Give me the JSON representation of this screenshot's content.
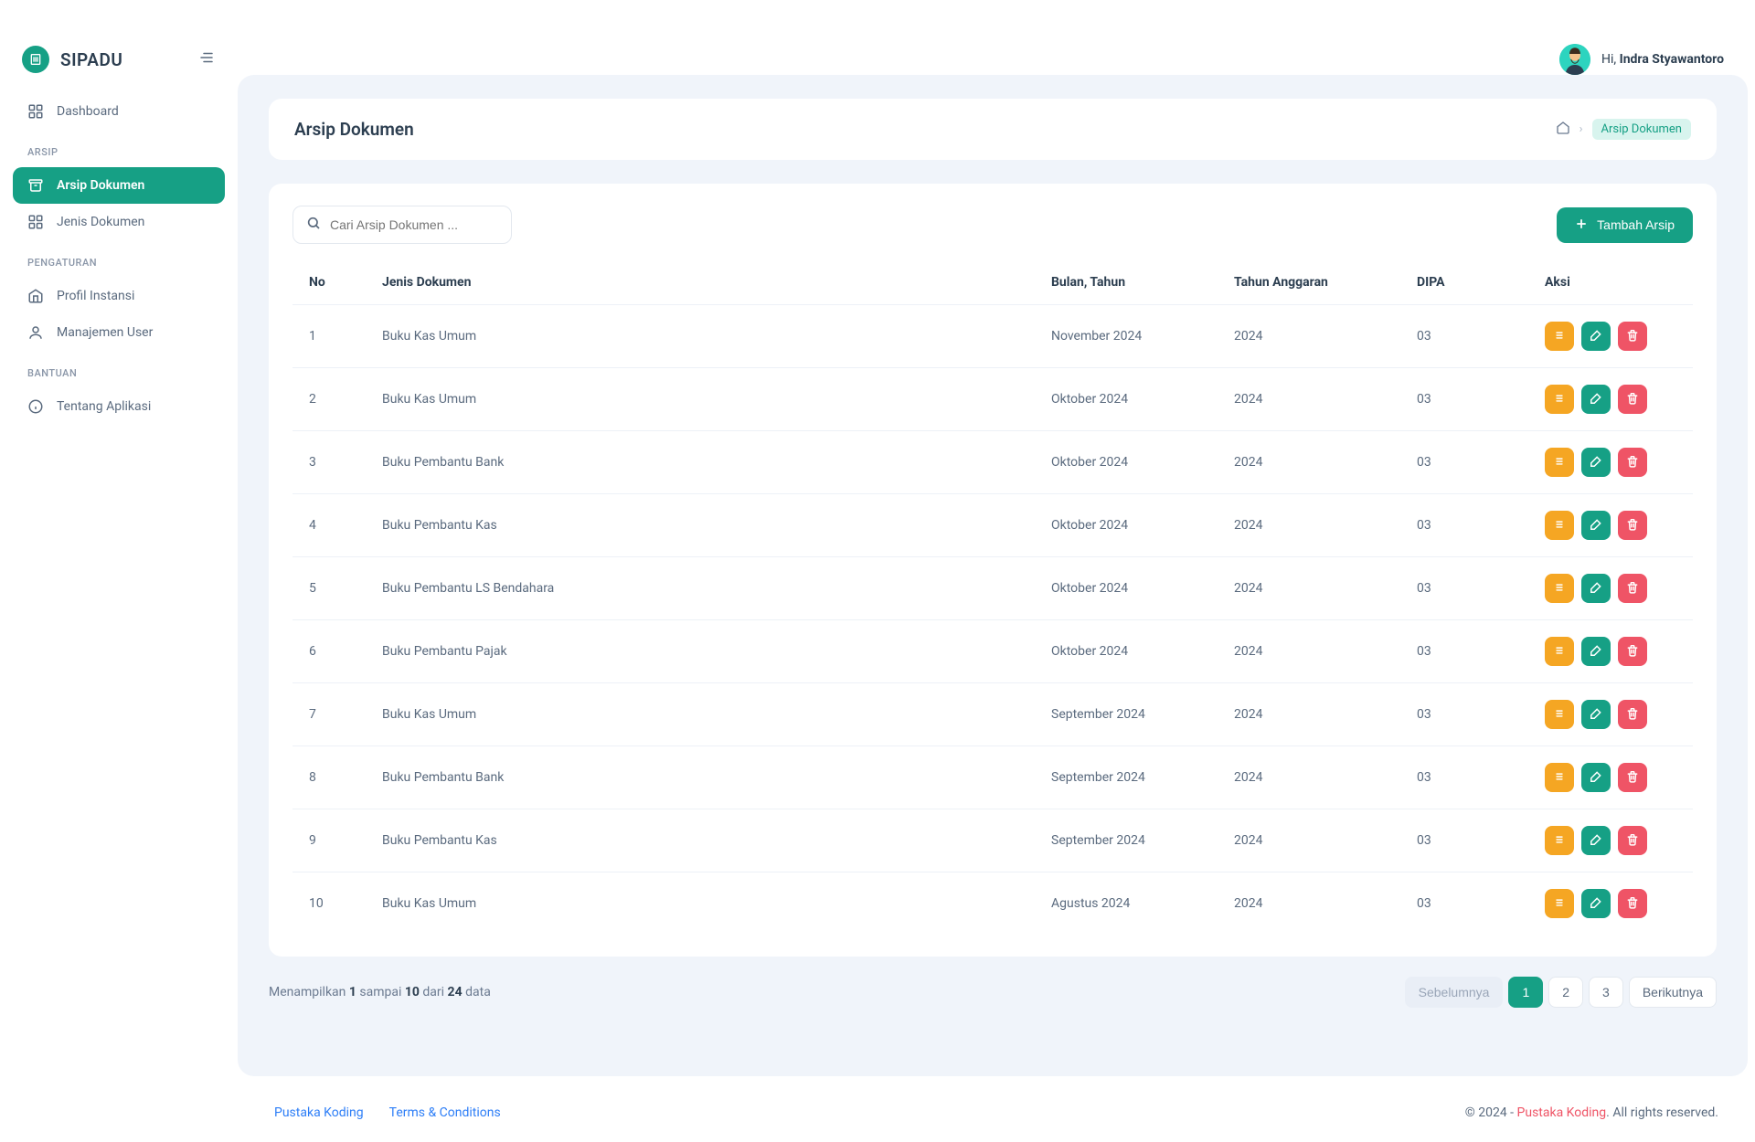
{
  "brand": {
    "name": "SIPADU"
  },
  "user": {
    "greeting": "Hi,",
    "name": "Indra Styawantoro"
  },
  "sidebar": {
    "items": [
      {
        "label": "Dashboard"
      }
    ],
    "sections": [
      {
        "title": "ARSIP",
        "items": [
          {
            "label": "Arsip Dokumen",
            "active": true
          },
          {
            "label": "Jenis Dokumen"
          }
        ]
      },
      {
        "title": "PENGATURAN",
        "items": [
          {
            "label": "Profil Instansi"
          },
          {
            "label": "Manajemen User"
          }
        ]
      },
      {
        "title": "BANTUAN",
        "items": [
          {
            "label": "Tentang Aplikasi"
          }
        ]
      }
    ]
  },
  "page": {
    "title": "Arsip Dokumen",
    "breadcrumb_current": "Arsip Dokumen"
  },
  "toolbar": {
    "search_placeholder": "Cari Arsip Dokumen ...",
    "add_label": "Tambah Arsip"
  },
  "table": {
    "headers": {
      "no": "No",
      "jenis": "Jenis Dokumen",
      "bulan": "Bulan, Tahun",
      "tahun": "Tahun Anggaran",
      "dipa": "DIPA",
      "aksi": "Aksi"
    },
    "rows": [
      {
        "no": "1",
        "jenis": "Buku Kas Umum",
        "bulan": "November 2024",
        "tahun": "2024",
        "dipa": "03"
      },
      {
        "no": "2",
        "jenis": "Buku Kas Umum",
        "bulan": "Oktober 2024",
        "tahun": "2024",
        "dipa": "03"
      },
      {
        "no": "3",
        "jenis": "Buku Pembantu Bank",
        "bulan": "Oktober 2024",
        "tahun": "2024",
        "dipa": "03"
      },
      {
        "no": "4",
        "jenis": "Buku Pembantu Kas",
        "bulan": "Oktober 2024",
        "tahun": "2024",
        "dipa": "03"
      },
      {
        "no": "5",
        "jenis": "Buku Pembantu LS Bendahara",
        "bulan": "Oktober 2024",
        "tahun": "2024",
        "dipa": "03"
      },
      {
        "no": "6",
        "jenis": "Buku Pembantu Pajak",
        "bulan": "Oktober 2024",
        "tahun": "2024",
        "dipa": "03"
      },
      {
        "no": "7",
        "jenis": "Buku Kas Umum",
        "bulan": "September 2024",
        "tahun": "2024",
        "dipa": "03"
      },
      {
        "no": "8",
        "jenis": "Buku Pembantu Bank",
        "bulan": "September 2024",
        "tahun": "2024",
        "dipa": "03"
      },
      {
        "no": "9",
        "jenis": "Buku Pembantu Kas",
        "bulan": "September 2024",
        "tahun": "2024",
        "dipa": "03"
      },
      {
        "no": "10",
        "jenis": "Buku Kas Umum",
        "bulan": "Agustus 2024",
        "tahun": "2024",
        "dipa": "03"
      }
    ]
  },
  "pagination": {
    "summary_prefix": "Menampilkan ",
    "from": "1",
    "mid1": " sampai ",
    "to": "10",
    "mid2": " dari ",
    "total": "24",
    "suffix": " data",
    "prev": "Sebelumnya",
    "next": "Berikutnya",
    "pages": [
      "1",
      "2",
      "3"
    ]
  },
  "footer": {
    "link1": "Pustaka Koding",
    "link2": "Terms & Conditions",
    "copy_prefix": "© 2024 - ",
    "copy_brand": "Pustaka Koding",
    "copy_suffix": ". All rights reserved."
  }
}
